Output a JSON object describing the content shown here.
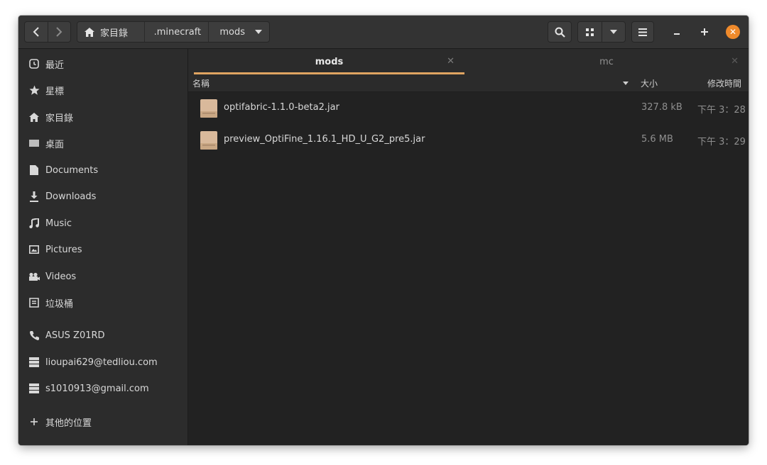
{
  "header": {
    "breadcrumbs": [
      {
        "label": "家目錄",
        "icon": "home-icon"
      },
      {
        "label": ".minecraft"
      },
      {
        "label": "mods"
      }
    ]
  },
  "sidebar": {
    "items": [
      {
        "label": "最近",
        "icon": "clock-icon"
      },
      {
        "label": "星標",
        "icon": "star-icon"
      },
      {
        "label": "家目錄",
        "icon": "home-icon"
      },
      {
        "label": "桌面",
        "icon": "desktop-icon"
      },
      {
        "label": "Documents",
        "icon": "document-icon"
      },
      {
        "label": "Downloads",
        "icon": "download-icon"
      },
      {
        "label": "Music",
        "icon": "music-icon"
      },
      {
        "label": "Pictures",
        "icon": "picture-icon"
      },
      {
        "label": "Videos",
        "icon": "video-icon"
      },
      {
        "label": "垃圾桶",
        "icon": "trash-icon"
      },
      {
        "label": "ASUS Z01RD",
        "icon": "phone-icon"
      },
      {
        "label": "lioupai629@tedliou.com",
        "icon": "server-icon"
      },
      {
        "label": "s1010913@gmail.com",
        "icon": "server-icon"
      },
      {
        "label": "其他的位置",
        "icon": "plus-icon"
      }
    ]
  },
  "tabs": [
    {
      "label": "mods",
      "active": true
    },
    {
      "label": "mc",
      "active": false
    }
  ],
  "columns": {
    "name": "名稱",
    "size": "大小",
    "modified": "修改時間"
  },
  "files": [
    {
      "name": "optifabric-1.1.0-beta2.jar",
      "size": "327.8 kB",
      "modified": "下午 3：28"
    },
    {
      "name": "preview_OptiFine_1.16.1_HD_U_G2_pre5.jar",
      "size": "5.6 MB",
      "modified": "下午 3：29"
    }
  ],
  "colors": {
    "accent": "#e0a461",
    "close": "#ef8a2b"
  }
}
